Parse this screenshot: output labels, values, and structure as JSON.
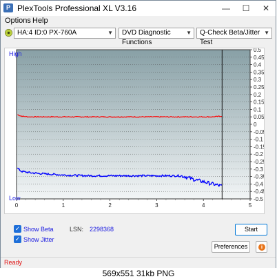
{
  "window": {
    "title": "PlexTools Professional XL V3.16",
    "app_icon": "plextools-logo-icon",
    "controls": {
      "minimize": "—",
      "maximize": "☐",
      "close": "✕"
    }
  },
  "menu": {
    "items": [
      "Options",
      "Help"
    ]
  },
  "toolbar": {
    "drive_icon": "disc-icon",
    "drive": "HA:4 ID:0  PX-760A",
    "function": "DVD Diagnostic Functions",
    "test": "Q-Check Beta/Jitter Test"
  },
  "chart_data": {
    "type": "line",
    "left_axis_labels": {
      "top": "High",
      "bottom": "Low"
    },
    "x": {
      "ticks": [
        "0",
        "1",
        "2",
        "3",
        "4",
        "5"
      ],
      "range": [
        0,
        5
      ]
    },
    "y_right": {
      "range": [
        -0.5,
        0.5
      ],
      "ticks": [
        "0.5",
        "0.45",
        "0.4",
        "0.35",
        "0.3",
        "0.25",
        "0.2",
        "0.15",
        "0.1",
        "0.05",
        "0",
        "-0.05",
        "-0.1",
        "-0.15",
        "-0.2",
        "-0.25",
        "-0.3",
        "-0.35",
        "-0.4",
        "-0.45",
        "-0.5"
      ]
    },
    "end_marker_x": 4.4,
    "series": [
      {
        "color": "#ff0000",
        "x": [
          0.02,
          0.1,
          0.25,
          0.5,
          1.0,
          1.5,
          2.0,
          2.5,
          3.0,
          3.5,
          4.0,
          4.2,
          4.4
        ],
        "y": [
          0.065,
          0.055,
          0.05,
          0.05,
          0.05,
          0.05,
          0.05,
          0.05,
          0.05,
          0.05,
          0.05,
          0.05,
          0.055
        ]
      },
      {
        "color": "#0000ff",
        "x": [
          0.02,
          0.1,
          0.3,
          0.5,
          1.0,
          1.5,
          2.0,
          2.5,
          3.0,
          3.5,
          3.6,
          3.8,
          4.0,
          4.2,
          4.4
        ],
        "y": [
          -0.295,
          -0.315,
          -0.325,
          -0.33,
          -0.34,
          -0.345,
          -0.345,
          -0.345,
          -0.345,
          -0.345,
          -0.35,
          -0.37,
          -0.385,
          -0.4,
          -0.415
        ]
      }
    ],
    "colors": {
      "plot_top": "#88a0a6",
      "plot_bottom": "#f2f5f6",
      "grid": "#555555"
    }
  },
  "options": {
    "show_beta": {
      "label": "Show Beta",
      "checked": true
    },
    "show_jitter": {
      "label": "Show Jitter",
      "checked": true
    }
  },
  "lsn": {
    "label": "LSN:",
    "value": "2298368"
  },
  "buttons": {
    "start": "Start",
    "preferences": "Preferences",
    "info_icon": "info-icon"
  },
  "status": {
    "text": "Ready"
  },
  "caption": "569x551  31kb  PNG"
}
